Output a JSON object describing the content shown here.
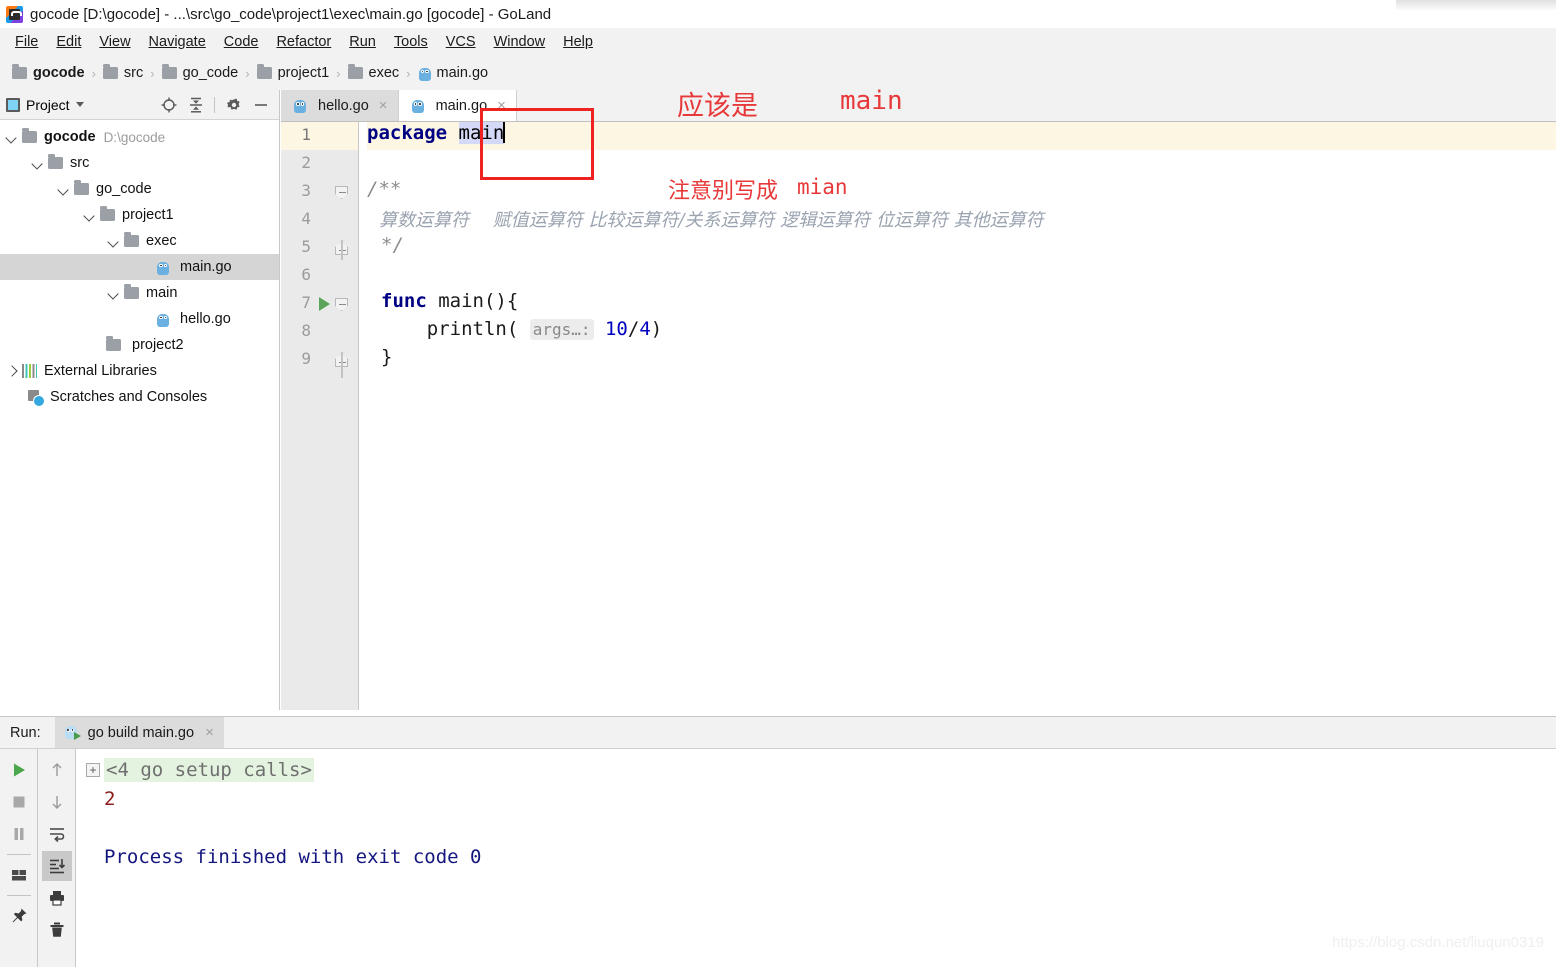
{
  "window": {
    "title": "gocode [D:\\gocode] - ...\\src\\go_code\\project1\\exec\\main.go [gocode] - GoLand",
    "app_icon": "goland-icon"
  },
  "menubar": {
    "items": [
      {
        "label": "File"
      },
      {
        "label": "Edit"
      },
      {
        "label": "View"
      },
      {
        "label": "Navigate"
      },
      {
        "label": "Code"
      },
      {
        "label": "Refactor"
      },
      {
        "label": "Run"
      },
      {
        "label": "Tools"
      },
      {
        "label": "VCS"
      },
      {
        "label": "Window"
      },
      {
        "label": "Help"
      }
    ]
  },
  "breadcrumb": {
    "separator": "›",
    "items": [
      {
        "label": "gocode",
        "icon": "folder-icon",
        "bold": true
      },
      {
        "label": "src",
        "icon": "folder-icon",
        "bold": false
      },
      {
        "label": "go_code",
        "icon": "folder-icon",
        "bold": false
      },
      {
        "label": "project1",
        "icon": "folder-icon",
        "bold": false
      },
      {
        "label": "exec",
        "icon": "folder-icon",
        "bold": false
      },
      {
        "label": "main.go",
        "icon": "go-file-icon",
        "bold": false
      }
    ]
  },
  "sidebar": {
    "title": "Project",
    "toolbar": [
      {
        "name": "locate-icon"
      },
      {
        "name": "collapse-all-icon"
      },
      {
        "name": "gear-icon"
      },
      {
        "name": "hide-icon"
      }
    ],
    "tree": [
      {
        "label": "gocode",
        "path": "D:\\gocode",
        "icon": "folder-icon",
        "chev": "down",
        "indent": 0,
        "bold": true,
        "selected": false
      },
      {
        "label": "src",
        "path": "",
        "icon": "folder-icon",
        "chev": "down",
        "indent": 1,
        "bold": false,
        "selected": false
      },
      {
        "label": "go_code",
        "path": "",
        "icon": "folder-icon",
        "chev": "down",
        "indent": 2,
        "bold": false,
        "selected": false
      },
      {
        "label": "project1",
        "path": "",
        "icon": "folder-icon",
        "chev": "down",
        "indent": 3,
        "bold": false,
        "selected": false
      },
      {
        "label": "exec",
        "path": "",
        "icon": "folder-icon",
        "chev": "down",
        "indent": 4,
        "bold": false,
        "selected": false
      },
      {
        "label": "main.go",
        "path": "",
        "icon": "go-file-icon",
        "chev": "none",
        "indent": 6,
        "bold": false,
        "selected": true
      },
      {
        "label": "main",
        "path": "",
        "icon": "folder-icon",
        "chev": "down",
        "indent": 4,
        "bold": false,
        "selected": false
      },
      {
        "label": "hello.go",
        "path": "",
        "icon": "go-file-icon",
        "chev": "none",
        "indent": 6,
        "bold": false,
        "selected": false
      },
      {
        "label": "project2",
        "path": "",
        "icon": "folder-icon",
        "chev": "none",
        "indent": 4,
        "bold": false,
        "selected": false
      },
      {
        "label": "External Libraries",
        "path": "",
        "icon": "libraries-icon",
        "chev": "right",
        "indent": 0,
        "bold": false,
        "selected": false
      },
      {
        "label": "Scratches and Consoles",
        "path": "",
        "icon": "scratches-icon",
        "chev": "none",
        "indent": 1,
        "bold": false,
        "selected": false
      }
    ]
  },
  "editor": {
    "tabs": [
      {
        "label": "hello.go",
        "icon": "go-file-icon",
        "active": false,
        "close": "×"
      },
      {
        "label": "main.go",
        "icon": "go-file-icon",
        "active": true,
        "close": "×"
      }
    ],
    "lines": [
      {
        "n": "1",
        "fold": "none",
        "run": false,
        "current": true
      },
      {
        "n": "2",
        "fold": "none",
        "run": false,
        "current": false
      },
      {
        "n": "3",
        "fold": "open",
        "run": false,
        "current": false
      },
      {
        "n": "4",
        "fold": "none",
        "run": false,
        "current": false
      },
      {
        "n": "5",
        "fold": "end",
        "run": false,
        "current": false
      },
      {
        "n": "6",
        "fold": "none",
        "run": false,
        "current": false
      },
      {
        "n": "7",
        "fold": "open",
        "run": true,
        "current": false
      },
      {
        "n": "8",
        "fold": "none",
        "run": false,
        "current": false
      },
      {
        "n": "9",
        "fold": "end",
        "run": false,
        "current": false
      }
    ],
    "code": {
      "l1_keyword": "package",
      "l1_selected_text": "main",
      "l3": "/**",
      "l4": "算数运算符　 赋值运算符 比较运算符/关系运算符 逻辑运算符 位运算符 其他运算符",
      "l5": "*/",
      "l7_kw": "func",
      "l7_rest": " main(){",
      "l8_call": "    println(",
      "l8_hint": "args…:",
      "l8_num1": "10",
      "l8_slash": "/",
      "l8_num2": "4",
      "l8_close": ")",
      "l9": "}"
    }
  },
  "annotations": {
    "box": {
      "name": "package-name-highlight-box",
      "color": "#ef2222"
    },
    "note1_cn": "应该是",
    "note1_en": "main",
    "note2_cn": "注意别写成",
    "note2_en": "mian"
  },
  "run_window": {
    "label": "Run:",
    "tab": {
      "label": "go build main.go",
      "icon": "go-run-icon",
      "close": "×"
    },
    "left_toolbar": [
      {
        "name": "rerun-button",
        "glyph": "play"
      },
      {
        "name": "stop-button",
        "glyph": "stop"
      },
      {
        "name": "pause-button",
        "glyph": "pause"
      },
      {
        "name": "layout-button",
        "glyph": "layout"
      },
      {
        "name": "pin-button",
        "glyph": "pin"
      }
    ],
    "right_toolbar": [
      {
        "name": "up-arrow-button",
        "glyph": "up"
      },
      {
        "name": "down-arrow-button",
        "glyph": "down"
      },
      {
        "name": "soft-wrap-button",
        "glyph": "wrap"
      },
      {
        "name": "scroll-to-end-button",
        "glyph": "scroll-end",
        "selected": true
      },
      {
        "name": "print-button",
        "glyph": "print"
      },
      {
        "name": "trash-button",
        "glyph": "trash"
      }
    ],
    "console": {
      "setup_calls": "<4 go setup calls>",
      "expand_glyph": "+",
      "output_value": "2",
      "finished": "Process finished with exit code 0"
    }
  },
  "watermark": "https://blog.csdn.net/liuqun0319"
}
